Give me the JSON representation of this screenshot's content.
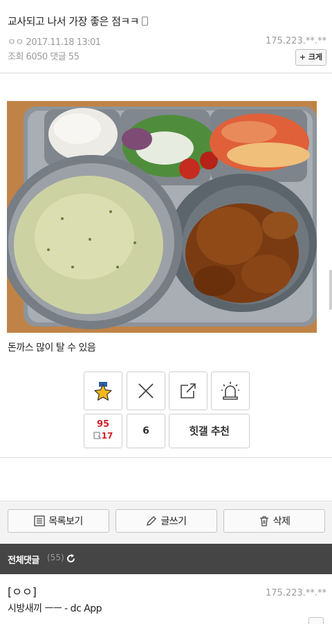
{
  "post": {
    "title": "교사되고 나서 가장 좋은 점ㅋㅋ",
    "author": "ㅇㅇ 2017.11.18 13:01",
    "views": "조회 6050 댓글 55",
    "ip": "175.223.**.**",
    "size_button": "크게",
    "caption": "돈까스 많이 탈 수 있음"
  },
  "votes": {
    "up_count": "95",
    "up_fix_count": "17",
    "down_count": "6",
    "recommend_label": "힛갤 추천"
  },
  "actions": {
    "list_label": "목록보기",
    "write_label": "글쓰기",
    "delete_label": "삭제"
  },
  "comments": {
    "header_label": "전체댓글",
    "count": "(55)",
    "items": [
      {
        "author": "[ㅇㅇ]",
        "text": "시방새끼 ㅡㅡ - dc App",
        "ip": "175.223.**.**"
      }
    ]
  },
  "colors": {
    "accent_red": "#d2232a",
    "comment_header_bg": "#454545"
  },
  "icons": [
    "phone-icon",
    "plus-icon",
    "star-icon",
    "x-icon",
    "share-icon",
    "siren-icon",
    "list-icon",
    "pencil-icon",
    "trash-icon",
    "refresh-icon",
    "chevron-icon"
  ]
}
